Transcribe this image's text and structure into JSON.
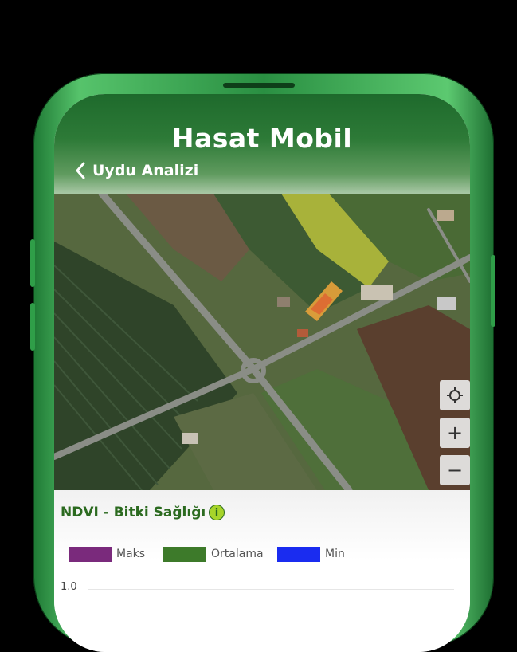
{
  "app": {
    "title": "Hasat Mobil"
  },
  "nav": {
    "back_label": "Uydu Analizi"
  },
  "map_controls": {
    "locate": "⌖",
    "zoom_in": "+",
    "zoom_out": "−"
  },
  "panel": {
    "title": "NDVI - Bitki Sağlığı",
    "info": "i",
    "legend": [
      {
        "label": "Maks",
        "color": "#7a2a7c"
      },
      {
        "label": "Ortalama",
        "color": "#3d7a2a"
      },
      {
        "label": "Min",
        "color": "#1a2cf0"
      }
    ],
    "y_tick": "1.0"
  }
}
